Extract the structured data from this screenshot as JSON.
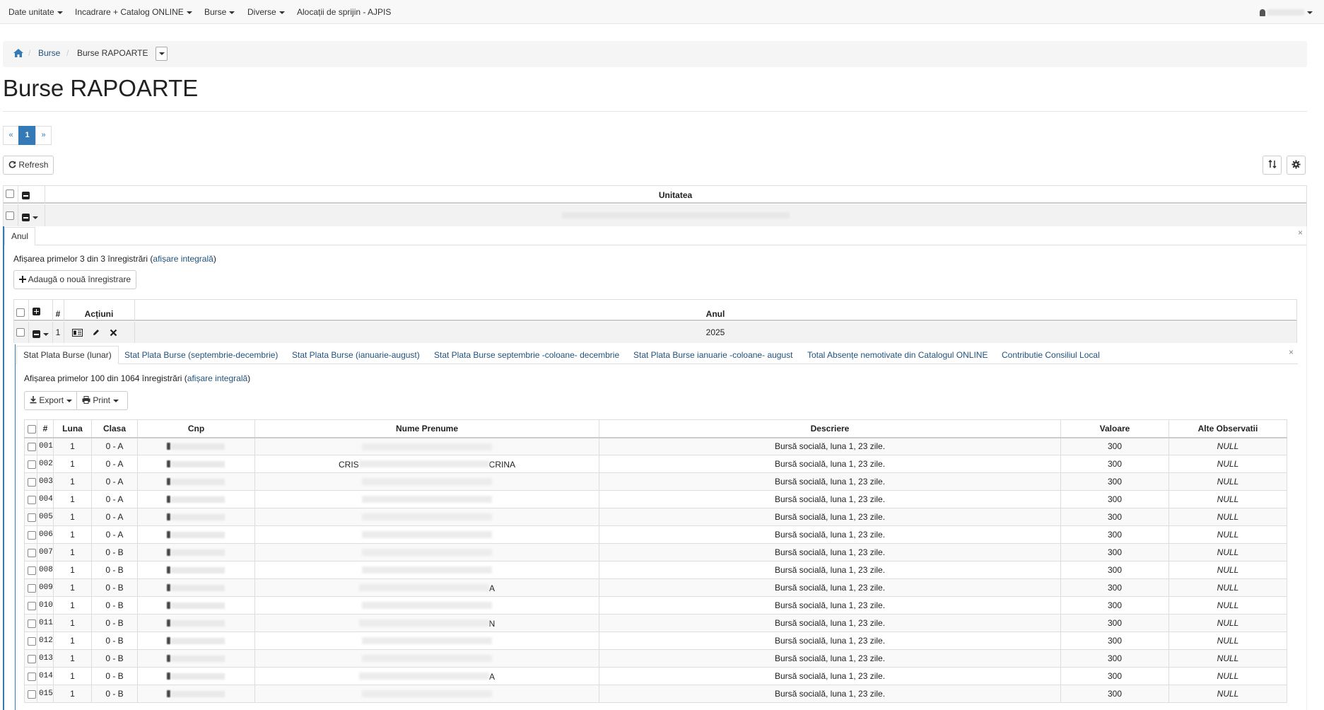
{
  "nav": {
    "items": [
      "Date unitate",
      "Incadrare + Catalog ONLINE",
      "Burse",
      "Diverse",
      "Alocații de sprijin - AJPIS"
    ]
  },
  "breadcrumb": {
    "link": "Burse",
    "current": "Burse RAPOARTE"
  },
  "page_title": "Burse RAPOARTE",
  "pager": {
    "prev": "«",
    "current": "1",
    "next": "»"
  },
  "toolbar": {
    "refresh_label": "Refresh"
  },
  "outer_table": {
    "header_unitatea": "Unitatea"
  },
  "anul_panel": {
    "tab_label": "Anul",
    "close": "×",
    "summary_prefix": "Afișarea primelor 3 din 3 înregistrări (",
    "summary_link": "afișare integrală",
    "summary_suffix": ")",
    "add_label": "Adaugă o nouă înregistrare",
    "header_hash": "#",
    "header_actions": "Acțiuni",
    "header_anul": "Anul",
    "row_index": "1",
    "row_year": "2025"
  },
  "report_tabs": [
    "Stat Plata Burse (lunar)",
    "Stat Plata Burse (septembrie-decembrie)",
    "Stat Plata Burse (ianuarie-august)",
    "Stat Plata Burse septembrie -coloane- decembrie",
    "Stat Plata Burse ianuarie -coloane- august",
    "Total Absențe nemotivate din Catalogul ONLINE",
    "Contributie Consiliul Local"
  ],
  "report": {
    "close": "×",
    "summary_prefix": "Afișarea primelor 100 din 1064 înregistrări (",
    "summary_link": "afișare integrală",
    "summary_suffix": ")",
    "export_label": "Export",
    "print_label": "Print",
    "columns": [
      "#",
      "Luna",
      "Clasa",
      "Cnp",
      "Nume Prenume",
      "Descriere",
      "Valoare",
      "Alte Observatii"
    ],
    "rows": [
      {
        "num": "001",
        "luna": "1",
        "clasa": "0 - A",
        "pre": "",
        "post": "",
        "descriere": "Bursă socială, luna 1, 23 zile.",
        "valoare": "300",
        "obs": "NULL"
      },
      {
        "num": "002",
        "luna": "1",
        "clasa": "0 - A",
        "pre": "CRIS",
        "post": "CRINA",
        "descriere": "Bursă socială, luna 1, 23 zile.",
        "valoare": "300",
        "obs": "NULL"
      },
      {
        "num": "003",
        "luna": "1",
        "clasa": "0 - A",
        "pre": "",
        "post": "",
        "descriere": "Bursă socială, luna 1, 23 zile.",
        "valoare": "300",
        "obs": "NULL"
      },
      {
        "num": "004",
        "luna": "1",
        "clasa": "0 - A",
        "pre": "",
        "post": "",
        "descriere": "Bursă socială, luna 1, 23 zile.",
        "valoare": "300",
        "obs": "NULL"
      },
      {
        "num": "005",
        "luna": "1",
        "clasa": "0 - A",
        "pre": "",
        "post": "",
        "descriere": "Bursă socială, luna 1, 23 zile.",
        "valoare": "300",
        "obs": "NULL"
      },
      {
        "num": "006",
        "luna": "1",
        "clasa": "0 - A",
        "pre": "",
        "post": "",
        "descriere": "Bursă socială, luna 1, 23 zile.",
        "valoare": "300",
        "obs": "NULL"
      },
      {
        "num": "007",
        "luna": "1",
        "clasa": "0 - B",
        "pre": "",
        "post": "",
        "descriere": "Bursă socială, luna 1, 23 zile.",
        "valoare": "300",
        "obs": "NULL"
      },
      {
        "num": "008",
        "luna": "1",
        "clasa": "0 - B",
        "pre": "",
        "post": "",
        "descriere": "Bursă socială, luna 1, 23 zile.",
        "valoare": "300",
        "obs": "NULL"
      },
      {
        "num": "009",
        "luna": "1",
        "clasa": "0 - B",
        "pre": "",
        "post": "A",
        "descriere": "Bursă socială, luna 1, 23 zile.",
        "valoare": "300",
        "obs": "NULL"
      },
      {
        "num": "010",
        "luna": "1",
        "clasa": "0 - B",
        "pre": "",
        "post": "",
        "descriere": "Bursă socială, luna 1, 23 zile.",
        "valoare": "300",
        "obs": "NULL"
      },
      {
        "num": "011",
        "luna": "1",
        "clasa": "0 - B",
        "pre": "",
        "post": "N",
        "descriere": "Bursă socială, luna 1, 23 zile.",
        "valoare": "300",
        "obs": "NULL"
      },
      {
        "num": "012",
        "luna": "1",
        "clasa": "0 - B",
        "pre": "",
        "post": "",
        "descriere": "Bursă socială, luna 1, 23 zile.",
        "valoare": "300",
        "obs": "NULL"
      },
      {
        "num": "013",
        "luna": "1",
        "clasa": "0 - B",
        "pre": "",
        "post": "",
        "descriere": "Bursă socială, luna 1, 23 zile.",
        "valoare": "300",
        "obs": "NULL"
      },
      {
        "num": "014",
        "luna": "1",
        "clasa": "0 - B",
        "pre": "",
        "post": "A",
        "descriere": "Bursă socială, luna 1, 23 zile.",
        "valoare": "300",
        "obs": "NULL"
      },
      {
        "num": "015",
        "luna": "1",
        "clasa": "0 - B",
        "pre": "",
        "post": "",
        "descriere": "Bursă socială, luna 1, 23 zile.",
        "valoare": "300",
        "obs": "NULL"
      }
    ]
  },
  "colors": {
    "link": "#23527c",
    "accent": "#337ab7"
  }
}
